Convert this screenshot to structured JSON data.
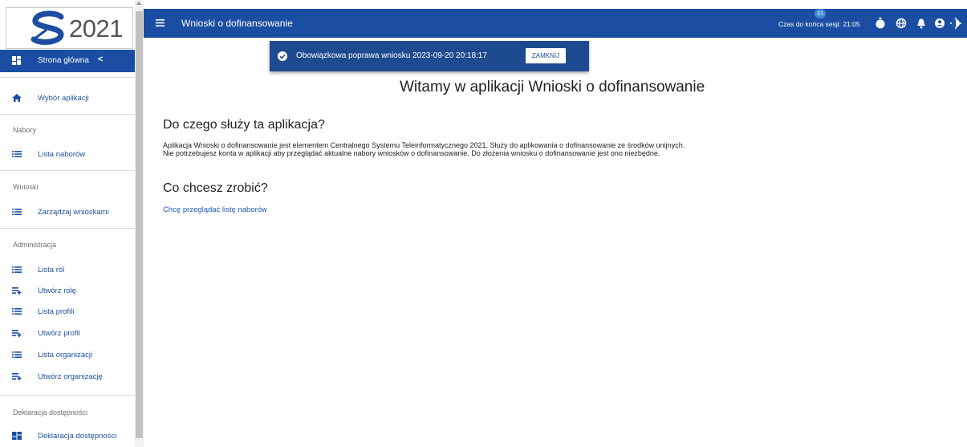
{
  "logo": {
    "text": "2021"
  },
  "sidebar": {
    "home_label": "Strona główna",
    "home_chevron": "<",
    "items": [
      {
        "label": "Wybór aplikacji",
        "icon": "home-icon"
      },
      {
        "label": "Lista naborów",
        "icon": "list-icon"
      },
      {
        "label": "Zarządzaj wnioskami",
        "icon": "list-icon"
      },
      {
        "label": "Lista ról",
        "icon": "list-icon"
      },
      {
        "label": "Utwórz rolę",
        "icon": "list-add-icon"
      },
      {
        "label": "Lista profili",
        "icon": "list-icon"
      },
      {
        "label": "Utwórz profil",
        "icon": "list-add-icon"
      },
      {
        "label": "Lista organizacji",
        "icon": "list-icon"
      },
      {
        "label": "Utwórz organizację",
        "icon": "list-add-icon"
      },
      {
        "label": "Deklaracja dostępności",
        "icon": "grid-icon"
      }
    ],
    "sections": [
      "Nabory",
      "Wnioski",
      "Administracja",
      "Deklaracja dostępności"
    ]
  },
  "topbar": {
    "title": "Wnioski o dofinansowanie",
    "session_label": "Czas do końca sesji: 21:05",
    "notification_count": "31"
  },
  "toast": {
    "message": "Obowiązkowa poprawa wniosku 2023-09-20 20:18:17",
    "button": "ZAMKNIJ"
  },
  "main": {
    "welcome": "Witamy w aplikacji Wnioski o dofinansowanie",
    "about_heading": "Do czego służy ta aplikacja?",
    "about_line1": "Aplikacja Wnioski o dofinansowanie jest elementem Centralnego Systemu Teleinformatycznego 2021. Służy do aplikowania o dofinansowanie ze środków unijnych.",
    "about_line2": "Nie potrzebujesz konta w aplikacji aby przeglądać aktualne nabory wniosków o dofinansowanie. Do złożenia wniosku o dofinansowanie jest ono niezbędne.",
    "action_heading": "Co chcesz zrobić?",
    "browse_link": "Chcę przeglądać listę naborów"
  },
  "colors": {
    "primary": "#1b4ea3",
    "toast": "#1e4b8f",
    "link": "#1c5cb5",
    "badge": "#3f86d6"
  }
}
